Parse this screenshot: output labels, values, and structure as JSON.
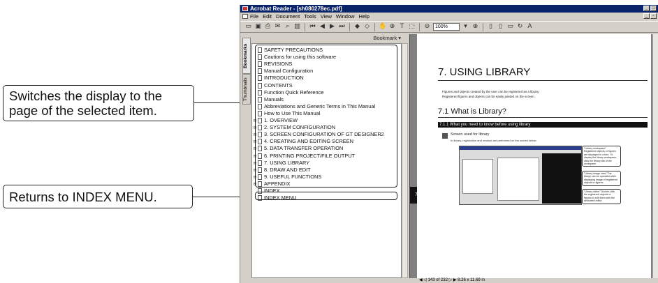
{
  "callouts": {
    "display_page": "Switches the display to the page of the selected item.",
    "index_menu": "Returns to INDEX MENU."
  },
  "app": {
    "title": "Acrobat Reader - [sh080278ec.pdf]",
    "menu": [
      "File",
      "Edit",
      "Document",
      "Tools",
      "View",
      "Window",
      "Help"
    ],
    "zoom": "100%"
  },
  "bookmarks": {
    "header": "Bookmark",
    "tabs": {
      "bookmarks": "Bookmarks",
      "thumbnails": "Thumbnails"
    },
    "items": [
      {
        "label": "SAFETY PRECAUTIONS",
        "expandable": false
      },
      {
        "label": "Cautions for using this software",
        "expandable": false
      },
      {
        "label": "REVISIONS",
        "expandable": false
      },
      {
        "label": "Manual Configuration",
        "expandable": false
      },
      {
        "label": "INTRODUCTION",
        "expandable": false
      },
      {
        "label": "CONTENTS",
        "expandable": false
      },
      {
        "label": "Function Quick Reference",
        "expandable": false
      },
      {
        "label": "Manuals",
        "expandable": false
      },
      {
        "label": "Abbreviations and Generic Terms in This Manual",
        "expandable": false
      },
      {
        "label": "How to Use This Manual",
        "expandable": false
      },
      {
        "label": "1. OVERVIEW",
        "expandable": true
      },
      {
        "label": "2. SYSTEM CONFIGURATION",
        "expandable": true
      },
      {
        "label": "3. SCREEN CONFIGURATION OF GT DESIGNER2",
        "expandable": true
      },
      {
        "label": "4. CREATING AND EDITING SCREEN",
        "expandable": true
      },
      {
        "label": "5. DATA TRANSFER OPERATION",
        "expandable": true
      },
      {
        "label": "6. PRINTING PROJECT/FILE OUTPUT",
        "expandable": true
      },
      {
        "label": "7. USING LIBRARY",
        "expandable": true
      },
      {
        "label": "8. DRAW AND EDIT",
        "expandable": true
      },
      {
        "label": "9. USEFUL FUNCTIONS",
        "expandable": true
      },
      {
        "label": "APPENDIX",
        "expandable": true
      },
      {
        "label": "INDEX",
        "expandable": false
      },
      {
        "label": "INDEX MENU",
        "expandable": false
      }
    ]
  },
  "document": {
    "page_tab": "7",
    "heading": "7. USING LIBRARY",
    "intro_1": "Figures and objects created by the user can be registered as a library.",
    "intro_2": "Registered figures and objects can be easily pasted on the screen.",
    "section": "7.1 What is Library?",
    "subsection": "7.1.1 What you need to know before using library",
    "sub_title": "Screen used for library",
    "sub_text": "In library, registration and readout are performed on the screen below.",
    "notes": [
      "\"Library workspace\" Registered objects or figures are displayed in a tree. To display the library workspace, click the library tab of the workspace.",
      "\"Library image view\" The library can be operated while displaying image of registered objects or figures.",
      "\"Library editor\" Double-click the registered objects or figures to edit them with the dedicated editor."
    ]
  },
  "status": {
    "page": "143 of 232",
    "size": "8.26 x 11.69 in"
  }
}
